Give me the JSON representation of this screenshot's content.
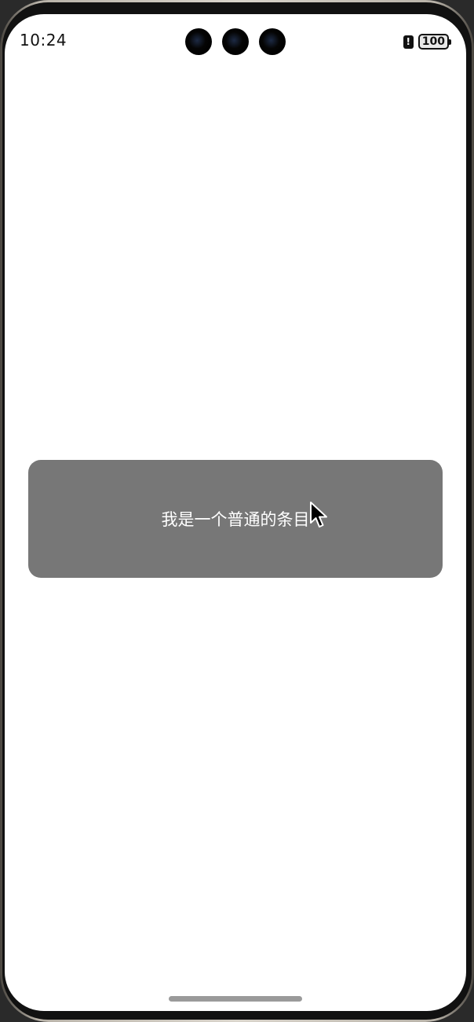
{
  "status_bar": {
    "time": "10:24",
    "battery_level": "100",
    "alert_glyph": "!"
  },
  "list": {
    "items": [
      {
        "label": "我是一个普通的条目"
      }
    ]
  },
  "icons": {
    "cameras": "front-camera-icon",
    "alert": "alert-icon",
    "battery": "battery-icon",
    "cursor": "mouse-cursor-icon"
  },
  "colors": {
    "item_background": "#777777",
    "item_text": "#ffffff",
    "screen_background": "#ffffff"
  }
}
